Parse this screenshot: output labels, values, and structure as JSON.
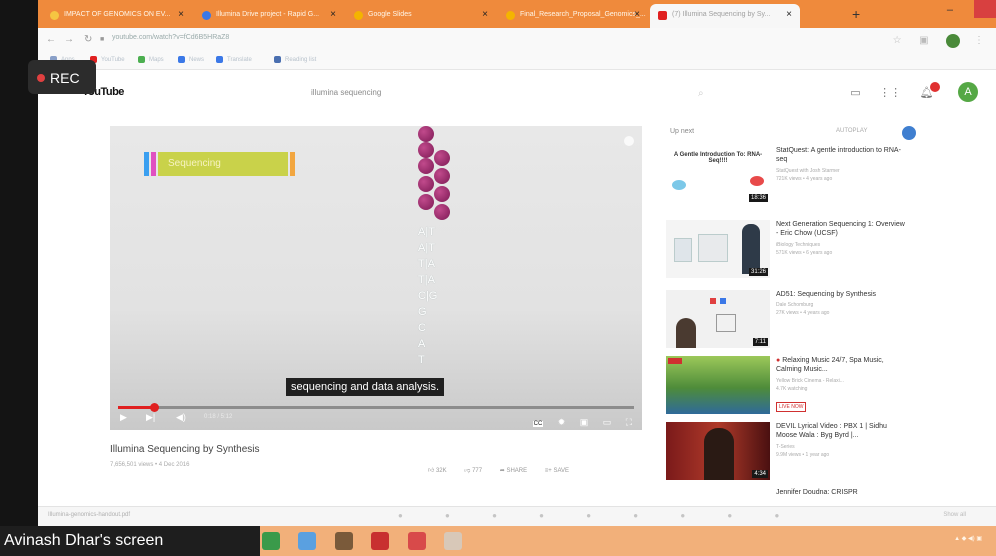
{
  "screen_share": {
    "rec_label": "REC",
    "sharer_label": "Avinash Dhar's screen"
  },
  "browser": {
    "tabs": [
      {
        "label": "IMPACT OF GENOMICS ON EV...",
        "favicon_color": "#f5c542"
      },
      {
        "label": "Illumina Drive project - Rapid G...",
        "favicon_color": "#3b78e7"
      },
      {
        "label": "Google Slides",
        "favicon_color": "#f4b400"
      },
      {
        "label": "Final_Research_Proposal_Genomics_...",
        "favicon_color": "#f4b400"
      },
      {
        "label": "(7) Illumina Sequencing by Sy...",
        "favicon_color": "#e02020"
      }
    ],
    "url": "youtube.com/watch?v=fCd6B5HRaZ8",
    "bookmarks": [
      "Apps",
      "YouTube",
      "Maps",
      "News",
      "Translate",
      "Reading list"
    ]
  },
  "youtube": {
    "logo_text": "YouTube",
    "search_query": "illumina sequencing",
    "avatar_letter": "A"
  },
  "video": {
    "sequencing_label": "Sequencing",
    "base_pairs": [
      "A|T",
      "A|T",
      "T|A",
      "T|A",
      "C|G",
      "G",
      "C",
      "A",
      "T"
    ],
    "caption": "sequencing and data analysis.",
    "progress": 0.07,
    "timecode": "0:18 / 5:12",
    "title": "Illumina Sequencing by Synthesis",
    "meta": "7,656,501 views • 4 Dec 2016",
    "likes": "32K",
    "dislikes": "777",
    "share": "SHARE",
    "save": "SAVE"
  },
  "upnext": {
    "heading": "Up next",
    "autoplay": "AUTOPLAY",
    "items": [
      {
        "title": "StatQuest: A gentle introduction to RNA-seq",
        "channel": "StatQuest with Josh Starmer",
        "views": "721K views • 4 years ago",
        "duration": "18:36",
        "thumb_text": "A Gentle Introduction To: RNA-Seq!!!!"
      },
      {
        "title": "Next Generation Sequencing 1: Overview - Eric Chow (UCSF)",
        "channel": "iBiology Techniques",
        "views": "571K views • 6 years ago",
        "duration": "31:26"
      },
      {
        "title": "AD51: Sequencing by Synthesis",
        "channel": "Dale Schomburg",
        "views": "27K views • 4 years ago",
        "duration": "7:11"
      },
      {
        "title": "Relaxing Music 24/7, Spa Music, Calming Music...",
        "channel": "Yellow Brick Cinema - Relaxi...",
        "views": "4.7K watching",
        "live": "LIVE NOW"
      },
      {
        "title": "DEVIL Lyrical Video : PBX 1 | Sidhu Moose Wala : Byg Byrd |...",
        "channel": "T-Series",
        "views": "9.9M views • 1 year ago",
        "duration": "4:34"
      },
      {
        "title": "Jennifer Doudna: CRISPR"
      }
    ]
  },
  "downloadbar": {
    "file": "Illumina-genomics-handout.pdf",
    "show_all": "Show all"
  },
  "colors": {
    "tab_strip": "#ef8a3c",
    "youtube_red": "#e02020",
    "taskbar": "#f2b07a"
  }
}
